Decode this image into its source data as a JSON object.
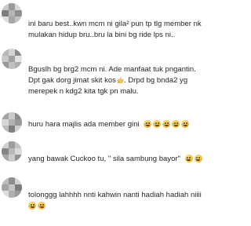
{
  "comments": [
    {
      "lines": [
        "ini baru best..kwn mcm ni gila² pun tp tlg member nk",
        "mulakan hidup bru..bru la bini bg ride lps ni.."
      ],
      "emoji_icons": []
    },
    {
      "lines": [
        "Bguslh bg brg2 mcm ni. Ade manfaat tuk pngantin.",
        "Dpt gak dorg jimat skit kos",
        "merepek n kdg2 kita tgk pn malu."
      ],
      "line2_suffix": ". Drpd bg bnda2 yg",
      "emoji_icons": [
        "thumbs-up-icon"
      ]
    },
    {
      "lines": [
        "huru hara majlis ada member gini"
      ],
      "emoji_icons": [
        "laughing-crying-icon",
        "laughing-crying-icon",
        "laughing-crying-icon",
        "laughing-crying-icon",
        "laughing-crying-icon"
      ]
    },
    {
      "lines": [
        "yang bawak Cuckoo tu, \" sila sambung bayor\""
      ],
      "emoji_icons": [
        "laughing-crying-icon",
        "laughing-crying-icon"
      ]
    },
    {
      "lines": [
        "tolonggg lahhhh nnti kahwin nanti hadiah hadiah niiii"
      ],
      "emoji_icons": [
        "laughing-crying-icon",
        "laughing-crying-icon"
      ]
    }
  ]
}
